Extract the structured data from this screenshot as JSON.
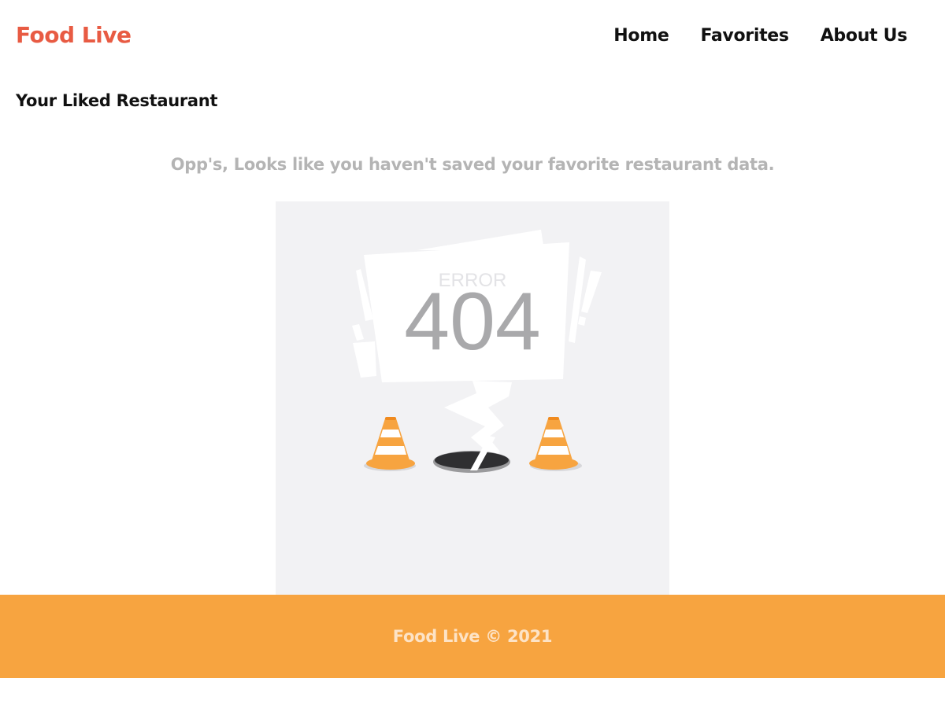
{
  "header": {
    "brand": "Food Live",
    "nav": [
      {
        "label": "Home"
      },
      {
        "label": "Favorites"
      },
      {
        "label": "About Us"
      }
    ]
  },
  "main": {
    "title": "Your Liked Restaurant",
    "empty_message": "Opp's, Looks like you haven't saved your favorite restaurant data.",
    "illustration": {
      "small_text": "ERROR",
      "big_text": "404"
    }
  },
  "footer": {
    "text": "Food Live © 2021"
  },
  "colors": {
    "brand": "#e85b43",
    "footer_bg": "#f7a440",
    "cone": "#f7a440",
    "muted_text": "#b4b4b4"
  }
}
